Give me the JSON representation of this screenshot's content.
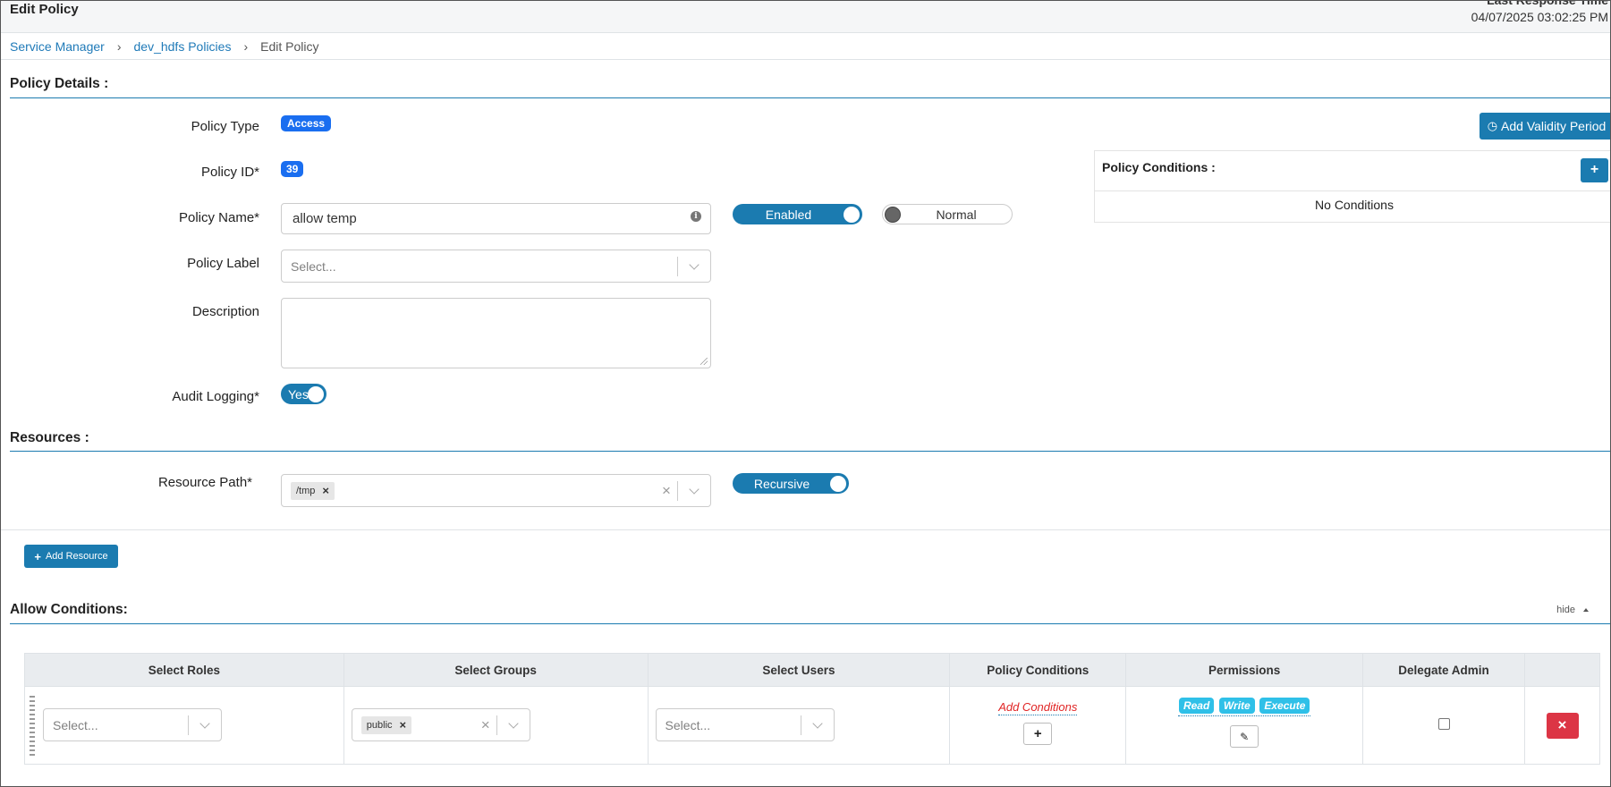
{
  "header": {
    "title": "Edit Policy",
    "last_response_label": "Last Response Time",
    "last_response_time": "04/07/2025 03:02:25 PM"
  },
  "breadcrumb": [
    "Service Manager",
    "dev_hdfs Policies",
    "Edit Policy"
  ],
  "policy_details": {
    "section_title": "Policy Details :",
    "policy_type_label": "Policy Type",
    "policy_type_value": "Access",
    "policy_id_label": "Policy ID*",
    "policy_id_value": "39",
    "policy_name_label": "Policy Name*",
    "policy_name_value": "allow temp",
    "enabled_toggle": "Enabled",
    "normal_toggle": "Normal",
    "policy_label_label": "Policy Label",
    "policy_label_placeholder": "Select...",
    "description_label": "Description",
    "audit_logging_label": "Audit Logging*",
    "audit_logging_value": "Yes",
    "add_validity_period": "Add Validity Period"
  },
  "policy_conditions_panel": {
    "title": "Policy Conditions :",
    "add_symbol": "+",
    "empty_text": "No Conditions"
  },
  "resources": {
    "section_title": "Resources :",
    "resource_path_label": "Resource Path*",
    "resource_path_tag": "/tmp",
    "recursive_toggle": "Recursive",
    "add_resource": "Add Resource"
  },
  "allow_conditions": {
    "section_title": "Allow Conditions:",
    "hide_label": "hide",
    "columns": [
      "Select Roles",
      "Select Groups",
      "Select Users",
      "Policy Conditions",
      "Permissions",
      "Delegate Admin",
      ""
    ],
    "row": {
      "roles_placeholder": "Select...",
      "group_tag": "public",
      "users_placeholder": "Select...",
      "add_conditions": "Add Conditions",
      "permissions": [
        "Read",
        "Write",
        "Execute"
      ]
    }
  },
  "colors": {
    "primary": "#1b7bb0",
    "badge": "#1a6ef0",
    "permission_tag": "#2fc0e8",
    "danger": "#dc3545",
    "link": "#1f7ab8"
  }
}
